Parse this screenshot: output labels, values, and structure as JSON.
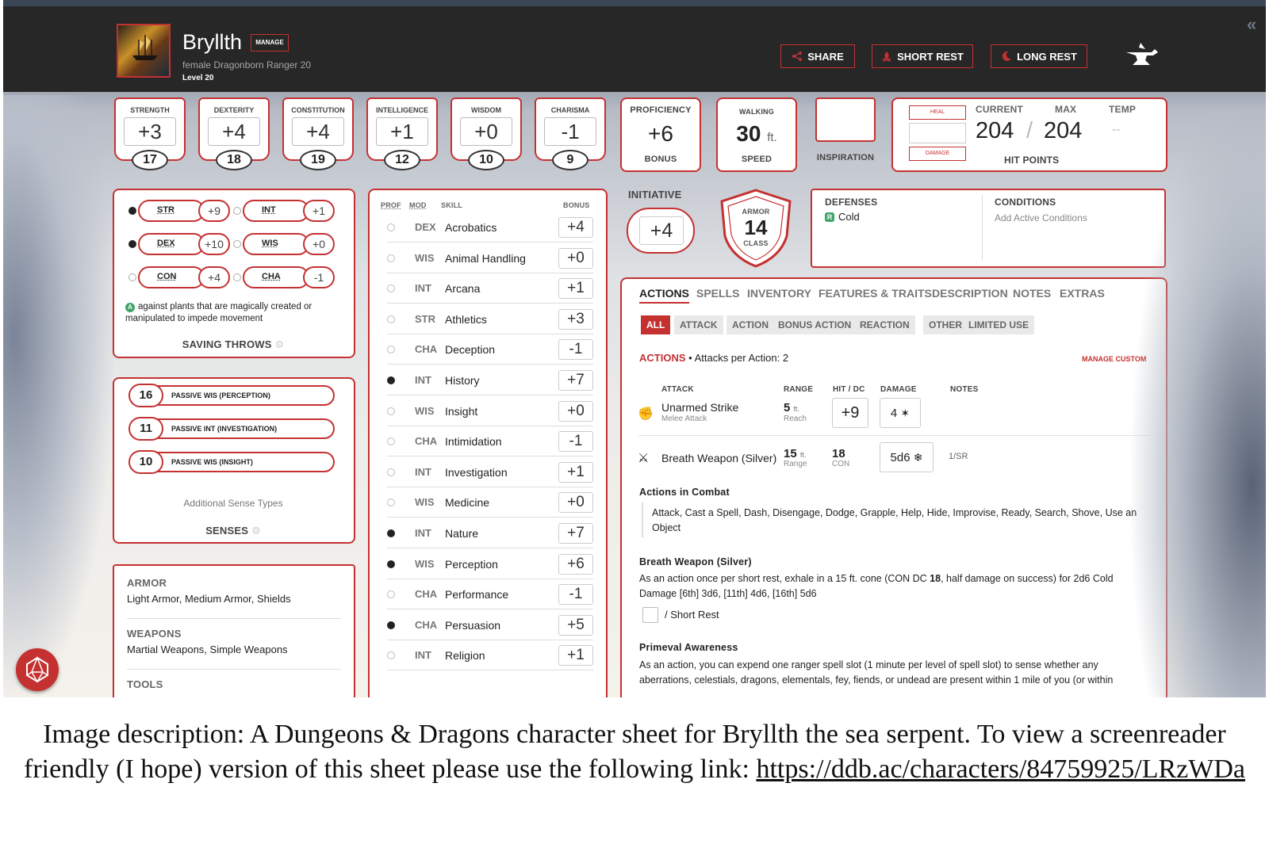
{
  "header": {
    "name": "Bryllth",
    "manage_label": "MANAGE",
    "subtitle": "female  Dragonborn  Ranger 20",
    "level": "Level 20",
    "share": "SHARE",
    "short_rest": "SHORT REST",
    "long_rest": "LONG REST"
  },
  "abilities": [
    {
      "label": "STRENGTH",
      "mod": "+3",
      "score": "17"
    },
    {
      "label": "DEXTERITY",
      "mod": "+4",
      "score": "18"
    },
    {
      "label": "CONSTITUTION",
      "mod": "+4",
      "score": "19"
    },
    {
      "label": "INTELLIGENCE",
      "mod": "+1",
      "score": "12"
    },
    {
      "label": "WISDOM",
      "mod": "+0",
      "score": "10"
    },
    {
      "label": "CHARISMA",
      "mod": "-1",
      "score": "9"
    }
  ],
  "proficiency": {
    "top": "PROFICIENCY",
    "value": "+6",
    "bottom": "BONUS"
  },
  "speed": {
    "top": "WALKING",
    "value": "30",
    "unit": "ft.",
    "bottom": "SPEED"
  },
  "inspiration": {
    "label": "INSPIRATION"
  },
  "hp": {
    "heal": "HEAL",
    "damage": "DAMAGE",
    "current_label": "CURRENT",
    "max_label": "MAX",
    "temp_label": "TEMP",
    "current": "204",
    "sep": "/",
    "max": "204",
    "temp": "--",
    "title": "HIT POINTS"
  },
  "initiative": {
    "label": "INITIATIVE",
    "value": "+4"
  },
  "armor_class": {
    "top": "ARMOR",
    "value": "14",
    "bottom": "CLASS"
  },
  "defenses": {
    "title": "DEFENSES",
    "value": "Cold"
  },
  "conditions": {
    "title": "CONDITIONS",
    "value": "Add Active Conditions"
  },
  "saving_throws": {
    "items": [
      {
        "name": "STR",
        "value": "+9",
        "prof": true
      },
      {
        "name": "INT",
        "value": "+1",
        "prof": false
      },
      {
        "name": "DEX",
        "value": "+10",
        "prof": true
      },
      {
        "name": "WIS",
        "value": "+0",
        "prof": false
      },
      {
        "name": "CON",
        "value": "+4",
        "prof": false
      },
      {
        "name": "CHA",
        "value": "-1",
        "prof": false
      }
    ],
    "note": "against plants that are magically created or manipulated to impede movement",
    "title": "SAVING THROWS"
  },
  "senses": {
    "items": [
      {
        "value": "16",
        "label": "PASSIVE WIS (PERCEPTION)"
      },
      {
        "value": "11",
        "label": "PASSIVE INT (INVESTIGATION)"
      },
      {
        "value": "10",
        "label": "PASSIVE WIS (INSIGHT)"
      }
    ],
    "additional": "Additional Sense Types",
    "title": "SENSES"
  },
  "proficiencies": {
    "armor_title": "ARMOR",
    "armor": "Light Armor, Medium Armor, Shields",
    "weapons_title": "WEAPONS",
    "weapons": "Martial Weapons, Simple Weapons",
    "tools_title": "TOOLS"
  },
  "skills": {
    "headers": {
      "prof": "PROF",
      "mod": "MOD",
      "skill": "SKILL",
      "bonus": "BONUS"
    },
    "items": [
      {
        "prof": false,
        "mod": "DEX",
        "name": "Acrobatics",
        "bonus": "+4"
      },
      {
        "prof": false,
        "mod": "WIS",
        "name": "Animal Handling",
        "bonus": "+0"
      },
      {
        "prof": false,
        "mod": "INT",
        "name": "Arcana",
        "bonus": "+1"
      },
      {
        "prof": false,
        "mod": "STR",
        "name": "Athletics",
        "bonus": "+3"
      },
      {
        "prof": false,
        "mod": "CHA",
        "name": "Deception",
        "bonus": "-1"
      },
      {
        "prof": true,
        "mod": "INT",
        "name": "History",
        "bonus": "+7"
      },
      {
        "prof": false,
        "mod": "WIS",
        "name": "Insight",
        "bonus": "+0"
      },
      {
        "prof": false,
        "mod": "CHA",
        "name": "Intimidation",
        "bonus": "-1"
      },
      {
        "prof": false,
        "mod": "INT",
        "name": "Investigation",
        "bonus": "+1"
      },
      {
        "prof": false,
        "mod": "WIS",
        "name": "Medicine",
        "bonus": "+0"
      },
      {
        "prof": true,
        "mod": "INT",
        "name": "Nature",
        "bonus": "+7"
      },
      {
        "prof": true,
        "mod": "WIS",
        "name": "Perception",
        "bonus": "+6"
      },
      {
        "prof": false,
        "mod": "CHA",
        "name": "Performance",
        "bonus": "-1"
      },
      {
        "prof": true,
        "mod": "CHA",
        "name": "Persuasion",
        "bonus": "+5"
      },
      {
        "prof": false,
        "mod": "INT",
        "name": "Religion",
        "bonus": "+1"
      }
    ]
  },
  "tabs": [
    "ACTIONS",
    "SPELLS",
    "INVENTORY",
    "FEATURES & TRAITS",
    "DESCRIPTION",
    "NOTES",
    "EXTRAS"
  ],
  "filters": [
    "ALL",
    "ATTACK",
    "ACTION",
    "BONUS ACTION",
    "REACTION",
    "OTHER",
    "LIMITED USE"
  ],
  "actions": {
    "title": "ACTIONS",
    "subtitle": "• Attacks per Action: 2",
    "manage_custom": "MANAGE CUSTOM",
    "cols": {
      "attack": "ATTACK",
      "range": "RANGE",
      "hit": "HIT / DC",
      "damage": "DAMAGE",
      "notes": "NOTES"
    },
    "rows": [
      {
        "name": "Unarmed Strike",
        "sub": "Melee Attack",
        "range": "5",
        "range_unit": "ft.",
        "range_sub": "Reach",
        "hit": "+9",
        "damage": "4",
        "notes": ""
      },
      {
        "name": "Breath Weapon (Silver)",
        "sub": "",
        "range": "15",
        "range_unit": "ft.",
        "range_sub": "Range",
        "hit": "18",
        "hit_sub": "CON",
        "damage": "5d6",
        "notes": "1/SR"
      }
    ],
    "combat_title": "Actions in Combat",
    "combat_list": "Attack, Cast a Spell, Dash, Disengage, Dodge, Grapple, Help, Hide, Improvise, Ready, Search, Shove, Use an Object",
    "breath_title": "Breath Weapon (Silver)",
    "breath_text_a": "As an action once per short rest, exhale in a 15 ft. cone (CON DC ",
    "breath_dc": "18",
    "breath_text_b": ", half damage on success) for 2d6 Cold Damage [6th] 3d6, [11th] 4d6, [16th] 5d6",
    "short_rest_sep": "/",
    "short_rest": "Short Rest",
    "primeval_title": "Primeval Awareness",
    "primeval_text": "As an action, you can expend one ranger spell slot (1 minute per level of spell slot) to sense whether any aberrations, celestials, dragons, elementals, fey, fiends, or undead are present within 1 mile of you (or within"
  },
  "caption": {
    "text": "Image description: A Dungeons & Dragons character sheet for Bryllth the sea serpent. To view a screenreader friendly (I hope) version of this sheet please use the following link: ",
    "link": "https://ddb.ac/characters/84759925/LRzWDa"
  },
  "colors": {
    "accent": "#c53131",
    "header_bg": "#272727"
  }
}
